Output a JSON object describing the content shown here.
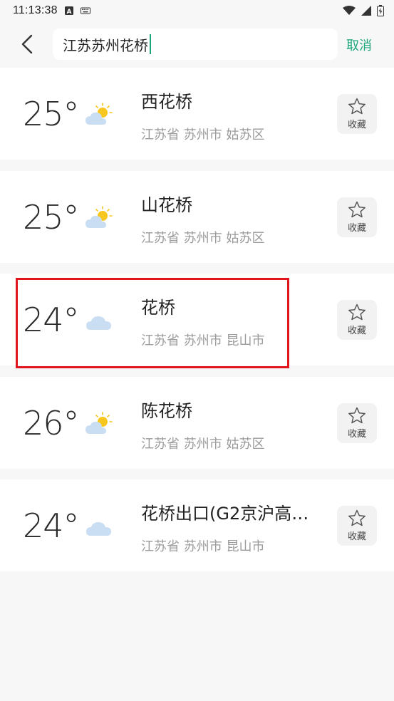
{
  "status_bar": {
    "time": "11:13:38",
    "icons": [
      "a-notification-icon",
      "keyboard-icon",
      "wifi-icon",
      "signal-icon",
      "battery-icon"
    ]
  },
  "search": {
    "query": "江苏苏州花桥",
    "cancel_label": "取消"
  },
  "colors": {
    "accent": "#1aa67a",
    "highlight": "#e0151d",
    "sun": "#f7c71f",
    "cloud": "#c9def2"
  },
  "results": [
    {
      "temp": "25°",
      "weather_icon": "partly-cloudy-icon",
      "name": "西花桥",
      "region": "江苏省 苏州市  姑苏区",
      "fav_label": "收藏"
    },
    {
      "temp": "25°",
      "weather_icon": "partly-cloudy-icon",
      "name": "山花桥",
      "region": "江苏省 苏州市  姑苏区",
      "fav_label": "收藏"
    },
    {
      "temp": "24°",
      "weather_icon": "cloudy-icon",
      "name": "花桥",
      "region": "江苏省 苏州市  昆山市",
      "fav_label": "收藏"
    },
    {
      "temp": "26°",
      "weather_icon": "partly-cloudy-icon",
      "name": "陈花桥",
      "region": "江苏省 苏州市  姑苏区",
      "fav_label": "收藏"
    },
    {
      "temp": "24°",
      "weather_icon": "cloudy-icon",
      "name": "花桥出口(G2京沪高…",
      "region": "江苏省 苏州市  昆山市",
      "fav_label": "收藏"
    }
  ]
}
